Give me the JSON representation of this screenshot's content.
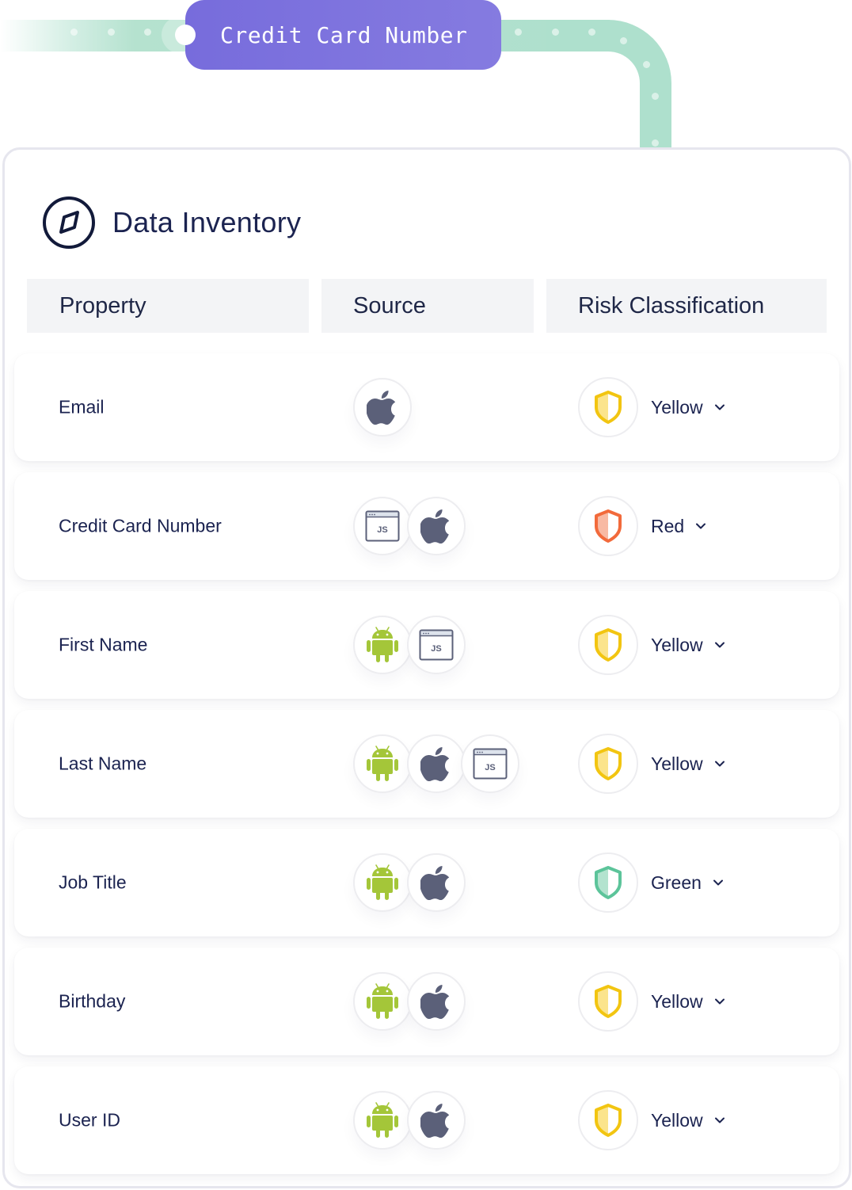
{
  "pipeline": {
    "tag_label": "Credit Card Number",
    "colors": {
      "tag": "#7b70de",
      "track": "#aee0cd"
    }
  },
  "inventory": {
    "title": "Data Inventory",
    "title_icon": "compass-icon",
    "columns": [
      {
        "label": "Property"
      },
      {
        "label": "Source"
      },
      {
        "label": "Risk Classification"
      }
    ],
    "rows": [
      {
        "property": "Email",
        "sources": [
          "apple-icon"
        ],
        "risk": "Yellow"
      },
      {
        "property": "Credit Card Number",
        "sources": [
          "javascript-icon",
          "apple-icon"
        ],
        "risk": "Red"
      },
      {
        "property": "First Name",
        "sources": [
          "android-icon",
          "javascript-icon"
        ],
        "risk": "Yellow"
      },
      {
        "property": "Last Name",
        "sources": [
          "android-icon",
          "apple-icon",
          "javascript-icon"
        ],
        "risk": "Yellow"
      },
      {
        "property": "Job Title",
        "sources": [
          "android-icon",
          "apple-icon"
        ],
        "risk": "Green"
      },
      {
        "property": "Birthday",
        "sources": [
          "android-icon",
          "apple-icon"
        ],
        "risk": "Yellow"
      },
      {
        "property": "User ID",
        "sources": [
          "android-icon",
          "apple-icon"
        ],
        "risk": "Yellow"
      }
    ],
    "risk_colors": {
      "Yellow": {
        "stroke": "#f2c511",
        "fill": "#fbe48c"
      },
      "Red": {
        "stroke": "#f26a3b",
        "fill": "#f8b9a3"
      },
      "Green": {
        "stroke": "#5cc49a",
        "fill": "#b3e3cf"
      }
    },
    "source_colors": {
      "android": "#a4c639",
      "apple": "#5b6079",
      "javascript": "#5b6079"
    }
  }
}
